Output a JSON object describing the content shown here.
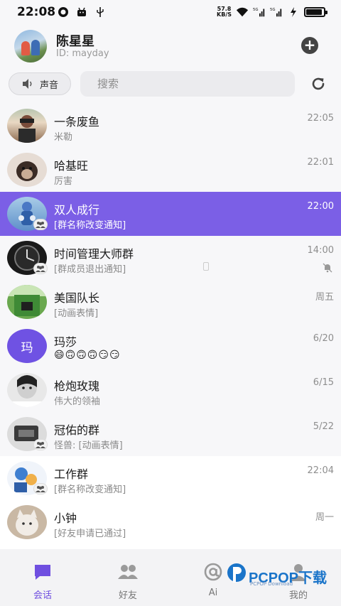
{
  "status_bar": {
    "time": "22:08",
    "speed_value": "57.8",
    "speed_unit": "KB/S",
    "battery_level": 0.9
  },
  "profile": {
    "name": "陈星星",
    "id_text": "ID: mayday"
  },
  "toolbar": {
    "sound_label": "声音",
    "search_placeholder": "搜索"
  },
  "conversations": [
    {
      "title": "一条废鱼",
      "subtitle": "米勒",
      "time": "22:05",
      "group": false
    },
    {
      "title": "哈基旺",
      "subtitle": "厉害",
      "time": "22:01",
      "group": false
    },
    {
      "title": "双人成行",
      "subtitle": "[群名称改变通知]",
      "time": "22:00",
      "group": true,
      "selected": true
    },
    {
      "title": "时间管理大师群",
      "subtitle": "[群成员退出通知]",
      "time": "14:00",
      "group": true,
      "muted": true
    },
    {
      "title": "美国队长",
      "subtitle": "[动画表情]",
      "time": "周五",
      "group": false
    },
    {
      "title": "玛莎",
      "subtitle": "😄🙃🙃🙃😏😏",
      "time": "6/20",
      "group": false,
      "avatar_text": "玛"
    },
    {
      "title": "枪炮玫瑰",
      "subtitle": "伟大的领袖",
      "time": "6/15",
      "group": false
    },
    {
      "title": "冠佑的群",
      "subtitle": "怪兽: [动画表情]",
      "time": "5/22",
      "group": true
    },
    {
      "title": "工作群",
      "subtitle": "[群名称改变通知]",
      "time": "22:04",
      "group": true
    },
    {
      "title": "小钟",
      "subtitle": "[好友申请已通过]",
      "time": "周一",
      "group": false
    }
  ],
  "tabs": [
    {
      "label": "会话",
      "icon": "chat-icon",
      "active": true
    },
    {
      "label": "好友",
      "icon": "friends-icon",
      "active": false
    },
    {
      "label": "Ai",
      "icon": "at-icon",
      "active": false
    },
    {
      "label": "我的",
      "icon": "person-icon",
      "active": false
    }
  ],
  "watermark": {
    "brand": "PCPOP下载",
    "small": "PCPOP Download"
  },
  "colors": {
    "accent": "#7b5fe6",
    "avatar_purple": "#6f52e3"
  }
}
